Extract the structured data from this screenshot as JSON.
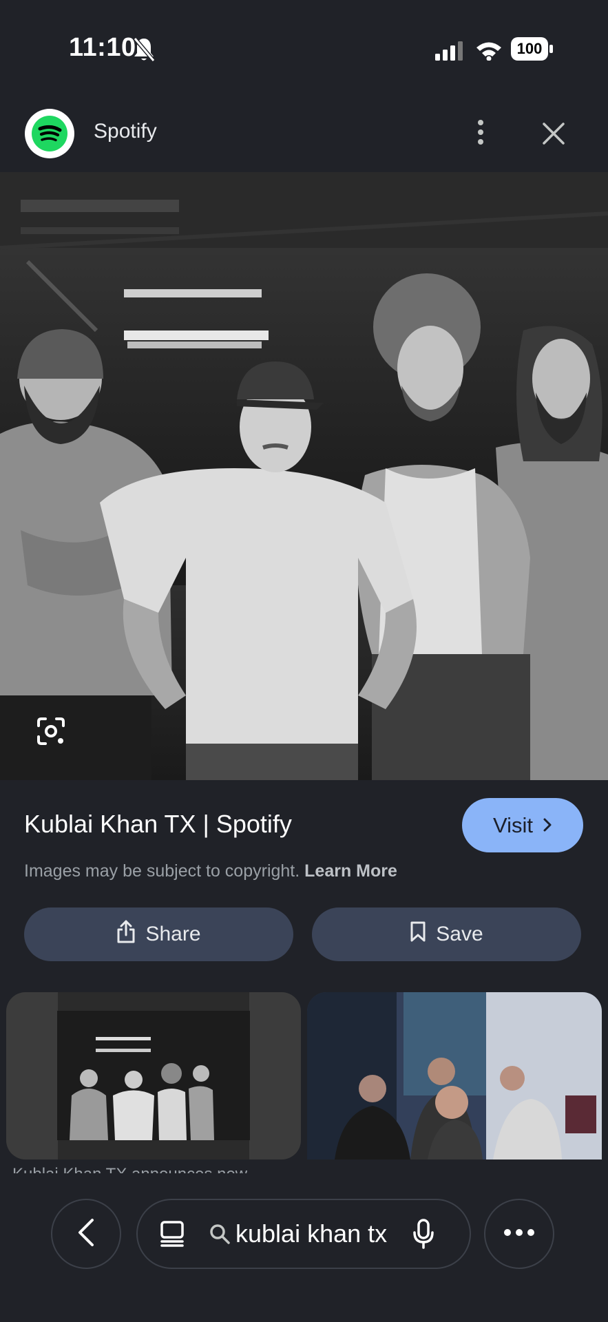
{
  "status_bar": {
    "time": "11:10",
    "battery": "100"
  },
  "header": {
    "source": "Spotify",
    "logo_icon": "spotify-logo",
    "accent": "#1ed760"
  },
  "result": {
    "title": "Kublai Khan TX | Spotify",
    "visit_label": "Visit",
    "copyright_text": "Images may be subject to copyright.",
    "learn_more": "Learn More",
    "share_label": "Share",
    "save_label": "Save"
  },
  "related": [
    {
      "caption": "Kublai Khan TX announces new"
    }
  ],
  "bottom_bar": {
    "query": "kublai khan tx"
  },
  "colors": {
    "background": "#202228",
    "visit_button": "#8ab4f8",
    "action_button": "#3b4458"
  }
}
